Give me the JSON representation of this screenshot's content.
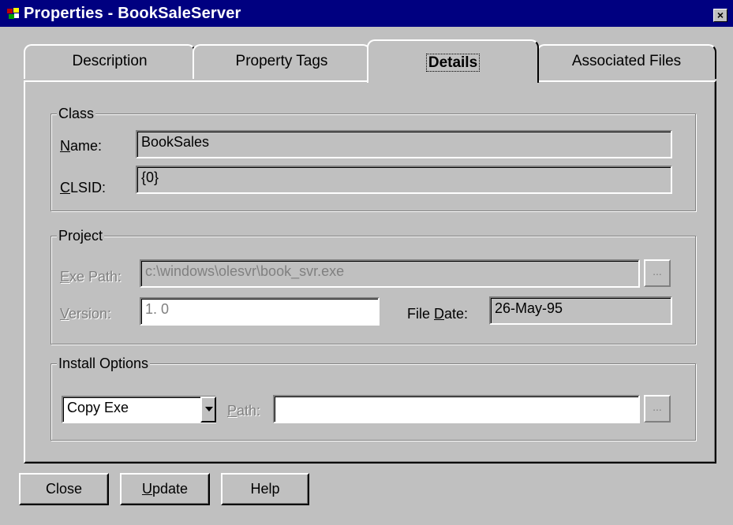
{
  "window": {
    "title": "Properties - BookSaleServer",
    "close_glyph": "×"
  },
  "tabs": [
    {
      "label": "Description"
    },
    {
      "label": "Property Tags"
    },
    {
      "label": "Details"
    },
    {
      "label": "Associated Files"
    }
  ],
  "class_group": {
    "title": "Class",
    "name_label_u": "N",
    "name_label_rest": "ame:",
    "name_value": "BookSales",
    "clsid_label_u": "C",
    "clsid_label_rest": "LSID:",
    "clsid_value": "{0}"
  },
  "project_group": {
    "title": "Project",
    "exe_label_u": "E",
    "exe_label_rest": "xe Path:",
    "exe_value": "c:\\windows\\olesvr\\book_svr.exe",
    "version_label_u": "V",
    "version_label_rest": "ersion:",
    "version_value": "1. 0",
    "filedate_label_pre": "File ",
    "filedate_label_u": "D",
    "filedate_label_rest": "ate:",
    "filedate_value": "26-May-95",
    "browse_label": "..."
  },
  "install_group": {
    "title": "Install Options",
    "option_selected": "Copy Exe",
    "path_label_u": "P",
    "path_label_rest": "ath:",
    "path_value": "",
    "browse_label": "..."
  },
  "buttons": {
    "close": "Close",
    "update_u": "U",
    "update_rest": "pdate",
    "help": "Help"
  }
}
